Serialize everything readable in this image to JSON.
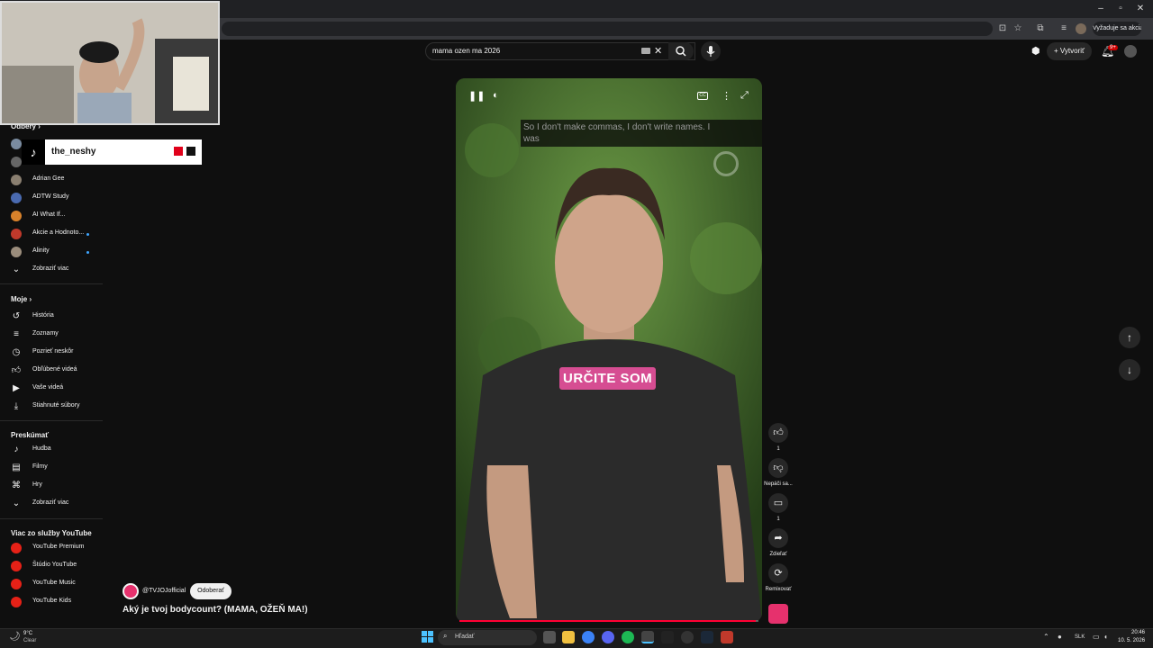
{
  "browser": {
    "profile_button": "Vyžaduje sa akcia"
  },
  "search": {
    "query": "mama ozen ma 2026"
  },
  "masthead": {
    "create_label": "Vytvoriť",
    "notifications_badge": "9+"
  },
  "overlay": {
    "tiktok_handle": "the_neshy"
  },
  "sidebar": {
    "subscriptions_title": "Odbery",
    "subscriptions": [
      {
        "label": "Adrian Gee",
        "avatar_color": "#8a7f70",
        "dot": false
      },
      {
        "label": "ADTW Study",
        "avatar_color": "#4a6ab0",
        "dot": false
      },
      {
        "label": "AI What If...",
        "avatar_color": "#d9822b",
        "dot": false
      },
      {
        "label": "Akcie a Hodnoto...",
        "avatar_color": "#c0392b",
        "dot": true
      },
      {
        "label": "Alinity",
        "avatar_color": "#9b8d7c",
        "dot": true
      }
    ],
    "show_more_1": "Zobraziť viac",
    "you_title": "Moje",
    "you_items": [
      {
        "label": "História",
        "icon": "history-icon"
      },
      {
        "label": "Zoznamy",
        "icon": "playlists-icon"
      },
      {
        "label": "Pozrieť neskôr",
        "icon": "watch-later-icon"
      },
      {
        "label": "Obľúbené videá",
        "icon": "liked-icon"
      },
      {
        "label": "Vaše videá",
        "icon": "your-videos-icon"
      },
      {
        "label": "Stiahnuté súbory",
        "icon": "downloads-icon"
      }
    ],
    "explore_title": "Preskúmať",
    "explore_items": [
      {
        "label": "Hudba",
        "icon": "music-icon"
      },
      {
        "label": "Filmy",
        "icon": "movies-icon"
      },
      {
        "label": "Hry",
        "icon": "gaming-icon"
      }
    ],
    "show_more_2": "Zobraziť viac",
    "more_title": "Viac zo služby YouTube",
    "more_items": [
      {
        "label": "YouTube Premium"
      },
      {
        "label": "Štúdio YouTube"
      },
      {
        "label": "YouTube Music"
      },
      {
        "label": "YouTube Kids"
      }
    ]
  },
  "player": {
    "closed_caption": "So I don't make commas, I don't write names.  I was",
    "burned_caption": "URČITE SOM",
    "progress": 0.99
  },
  "actions": {
    "like_count": "1",
    "dislike_label": "Nepáči sa...",
    "comments_count": "1",
    "share_label": "Zdieľať",
    "remix_label": "Remixovať"
  },
  "channel": {
    "handle": "@TVJOJofficial",
    "subscribe_label": "Odoberať",
    "video_title": "Aký je tvoj bodycount? (MAMA, OŽEŇ MA!)"
  },
  "taskbar": {
    "weather_temp": "9°C",
    "weather_desc": "Clear",
    "search_placeholder": "Hľadať",
    "language": "SLK",
    "time": "20:46",
    "date": "10. 5. 2026"
  },
  "colors": {
    "yt_red": "#ff0033",
    "caption_pink": "#d64d92",
    "accent_blue": "#3ea6ff"
  }
}
